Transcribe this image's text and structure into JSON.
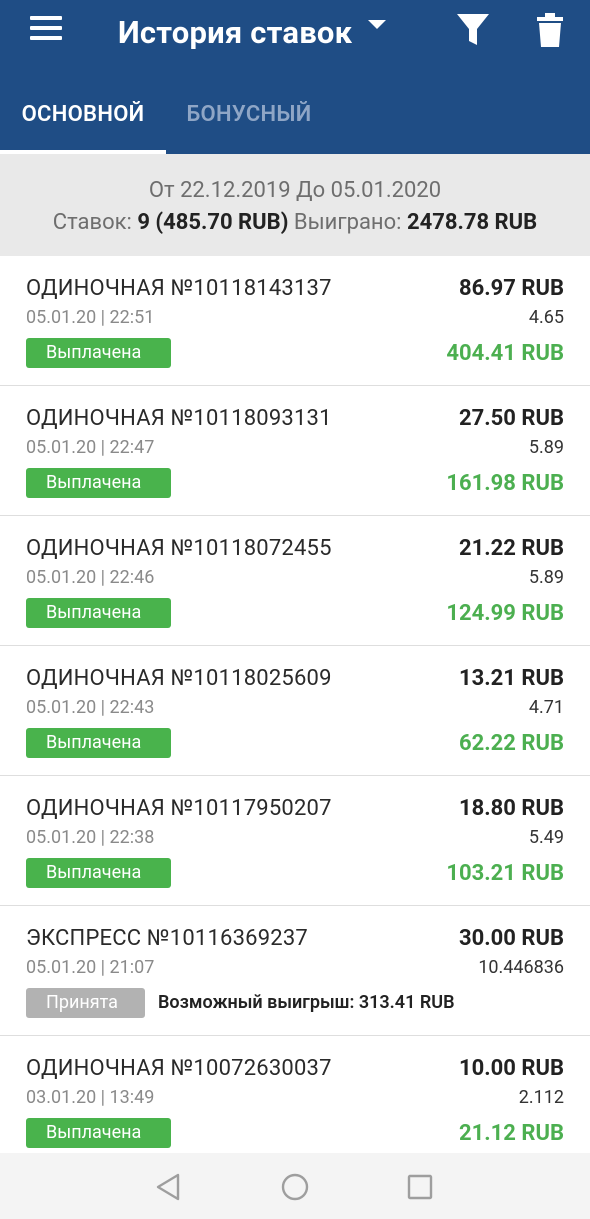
{
  "header": {
    "title": "История ставок",
    "tabs": [
      {
        "label": "ОСНОВНОЙ",
        "active": true
      },
      {
        "label": "БОНУСНЫЙ",
        "active": false
      }
    ]
  },
  "summary": {
    "range": "От 22.12.2019 До 05.01.2020",
    "bets_label": "Ставок:",
    "bets_value": "9 (485.70 RUB)",
    "won_label": "Выиграно:",
    "won_value": "2478.78 RUB"
  },
  "bets": [
    {
      "title": "ОДИНОЧНАЯ №10118143137",
      "date": "05.01.20 | 22:51",
      "status": "Выплачена",
      "stake": "86.97 RUB",
      "odds": "4.65",
      "win": "404.41 RUB"
    },
    {
      "title": "ОДИНОЧНАЯ №10118093131",
      "date": "05.01.20 | 22:47",
      "status": "Выплачена",
      "stake": "27.50 RUB",
      "odds": "5.89",
      "win": "161.98 RUB"
    },
    {
      "title": "ОДИНОЧНАЯ №10118072455",
      "date": "05.01.20 | 22:46",
      "status": "Выплачена",
      "stake": "21.22 RUB",
      "odds": "5.89",
      "win": "124.99 RUB"
    },
    {
      "title": "ОДИНОЧНАЯ №10118025609",
      "date": "05.01.20 | 22:43",
      "status": "Выплачена",
      "stake": "13.21 RUB",
      "odds": "4.71",
      "win": "62.22 RUB"
    },
    {
      "title": "ОДИНОЧНАЯ №10117950207",
      "date": "05.01.20 | 22:38",
      "status": "Выплачена",
      "stake": "18.80 RUB",
      "odds": "5.49",
      "win": "103.21 RUB"
    },
    {
      "title": "ЭКСПРЕСС №10116369237",
      "date": "05.01.20 | 21:07",
      "status": "Принята",
      "stake": "30.00 RUB",
      "odds": "10.446836",
      "possible": "Возможный выигрыш: 313.41 RUB"
    },
    {
      "title": "ОДИНОЧНАЯ №10072630037",
      "date": "03.01.20 | 13:49",
      "status": "Выплачена",
      "stake": "10.00 RUB",
      "odds": "2.112",
      "win": "21.12 RUB"
    }
  ],
  "colors": {
    "appbar": "#1f4d85",
    "paid_badge": "#49b34c",
    "accepted_badge": "#b2b2b2",
    "win_text": "#4caf50"
  },
  "icons": {
    "menu": "menu-icon",
    "dropdown": "caret-down-icon",
    "filter": "filter-icon",
    "delete": "trash-icon",
    "nav_back": "triangle-back-icon",
    "nav_home": "circle-home-icon",
    "nav_recent": "square-recent-icon"
  }
}
